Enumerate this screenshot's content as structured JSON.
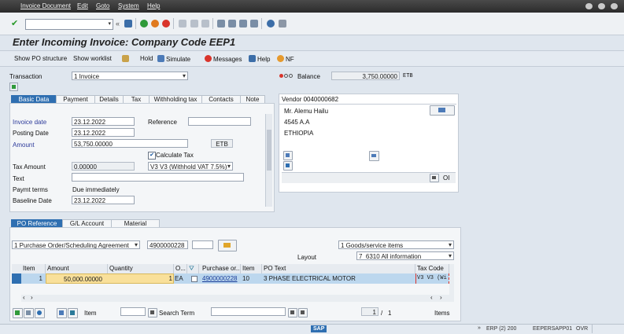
{
  "menu": [
    "Invoice Document",
    "Edit",
    "Goto",
    "System",
    "Help"
  ],
  "title": "Enter Incoming Invoice: Company Code EEP1",
  "app_toolbar": {
    "show_po_structure": "Show PO structure",
    "show_worklist": "Show worklist",
    "hold": "Hold",
    "simulate": "Simulate",
    "messages": "Messages",
    "help": "Help",
    "nf": "NF"
  },
  "header": {
    "transaction_label": "Transaction",
    "transaction_value": "1 Invoice",
    "balance_label": "Balance",
    "balance_value": "3,750.00000",
    "balance_currency": "ETB"
  },
  "basic_tabs": [
    "Basic Data",
    "Payment",
    "Details",
    "Tax",
    "Withholding tax",
    "Contacts",
    "Note"
  ],
  "basic": {
    "invoice_date_label": "Invoice date",
    "invoice_date": "23.12.2022",
    "reference_label": "Reference",
    "posting_date_label": "Posting Date",
    "posting_date": "23.12.2022",
    "amount_label": "Amount",
    "amount": "53,750.00000",
    "amount_currency": "ETB",
    "calculate_tax_label": "Calculate Tax",
    "tax_amount_label": "Tax Amount",
    "tax_amount": "0.00000",
    "tax_code": "V3 V3 (Withhold VAT 7.5%)",
    "text_label": "Text",
    "paymt_terms_label": "Paymt terms",
    "paymt_terms": "Due immediately",
    "baseline_date_label": "Baseline Date",
    "baseline_date": "23.12.2022"
  },
  "vendor": {
    "title": "Vendor 0040000682",
    "name": "Mr. Alemu Hailu",
    "address": "4545 A.A",
    "country": "ETHIOPIA",
    "oi": "OI"
  },
  "po_tabs": [
    "PO Reference",
    "G/L Account",
    "Material"
  ],
  "po": {
    "ref_type": "1 Purchase Order/Scheduling Agreement",
    "po_number": "4900000228",
    "goods_service": "1 Goods/service items",
    "layout_label": "Layout",
    "layout_value": "7_6310 All information"
  },
  "table": {
    "headers": [
      "Item",
      "Amount",
      "Quantity",
      "O...",
      "",
      "",
      "Purchase or...",
      "Item",
      "PO Text",
      "Tax Code"
    ],
    "rows": [
      {
        "item": "1",
        "amount": "50,000.00000",
        "quantity": "1",
        "unit": "EA",
        "po": "4900000228",
        "po_item": "10",
        "po_text": "3 PHASE ELECTRICAL MOTOR",
        "tax_code": "V3 V3 (Wi"
      }
    ]
  },
  "bottom": {
    "item_label": "Item",
    "search_term_label": "Search Term",
    "page_current": "1",
    "page_sep": "/",
    "page_total": "1",
    "items_label": "Items"
  },
  "status": {
    "sap": "SAP",
    "system": "ERP (2) 200",
    "server": "EEPERSAPP01",
    "mode": "OVR"
  },
  "colors": {
    "accent": "#2f6fb1",
    "selected_row": "#bcd7ee",
    "amount_cell": "#f9e09a"
  }
}
